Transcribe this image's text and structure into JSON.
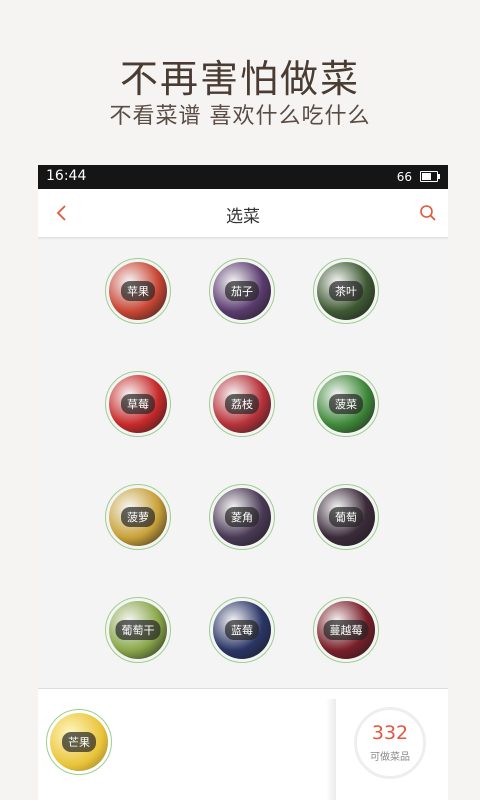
{
  "promo": {
    "title": "不再害怕做菜",
    "subtitle": "不看菜谱 喜欢什么吃什么"
  },
  "status_bar": {
    "time": "16:44",
    "battery": "66"
  },
  "nav": {
    "title": "选菜",
    "back_icon": "chevron-left-icon",
    "search_icon": "search-icon",
    "accent_color": "#e4573d"
  },
  "ingredients": [
    {
      "label": "苹果",
      "color": "#c94634"
    },
    {
      "label": "茄子",
      "color": "#5a3b6e"
    },
    {
      "label": "茶叶",
      "color": "#3f5a33"
    },
    {
      "label": "草莓",
      "color": "#c82a2a"
    },
    {
      "label": "荔枝",
      "color": "#b8323a"
    },
    {
      "label": "菠菜",
      "color": "#3f8a3a"
    },
    {
      "label": "菠萝",
      "color": "#c9a23a"
    },
    {
      "label": "菱角",
      "color": "#4a3a55"
    },
    {
      "label": "葡萄",
      "color": "#3b2b3a"
    },
    {
      "label": "葡萄干",
      "color": "#8aa74a"
    },
    {
      "label": "蓝莓",
      "color": "#2a3566"
    },
    {
      "label": "蔓越莓",
      "color": "#7a1f2a"
    }
  ],
  "selected": [
    {
      "label": "芒果",
      "color": "#e9c43a"
    }
  ],
  "dish_count": {
    "value": "332",
    "label": "可做菜品"
  }
}
